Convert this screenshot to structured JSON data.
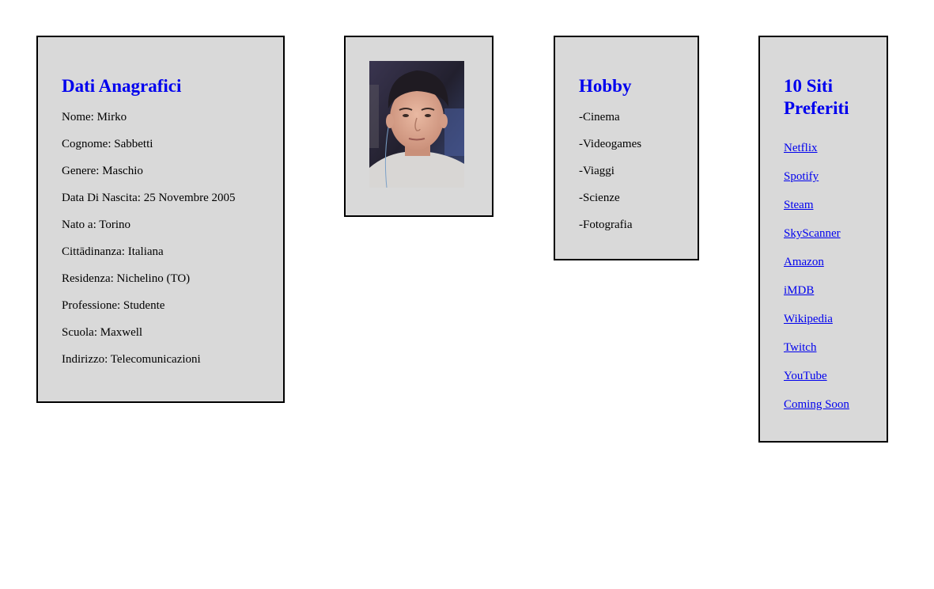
{
  "anagrafica": {
    "title": "Dati Anagrafici",
    "lines": [
      "Nome: Mirko",
      "Cognome: Sabbetti",
      "Genere: Maschio",
      "Data Di Nascita: 25 Novembre 2005",
      "Nato a: Torino",
      "Cittādinanza: Italiana",
      "Residenza: Nichelino (TO)",
      "Professione: Studente",
      "Scuola: Maxwell",
      "Indirizzo: Telecomunicazioni"
    ]
  },
  "photo": {
    "subject": "profile-photo"
  },
  "hobby": {
    "title": "Hobby",
    "items": [
      "-Cinema",
      "-Videogames",
      "-Viaggi",
      "-Scienze",
      "-Fotografia"
    ]
  },
  "siti": {
    "title_line1": "10 Siti",
    "title_line2": "Preferiti",
    "links": [
      "Netflix",
      "Spotify",
      "Steam",
      "SkyScanner",
      "Amazon",
      "iMDB",
      "Wikipedia",
      "Twitch",
      "YouTube",
      "Coming Soon"
    ]
  },
  "colors": {
    "heading": "#0000ee",
    "link": "#0000ee",
    "card_bg": "#d9d9d9",
    "border": "#000000"
  }
}
